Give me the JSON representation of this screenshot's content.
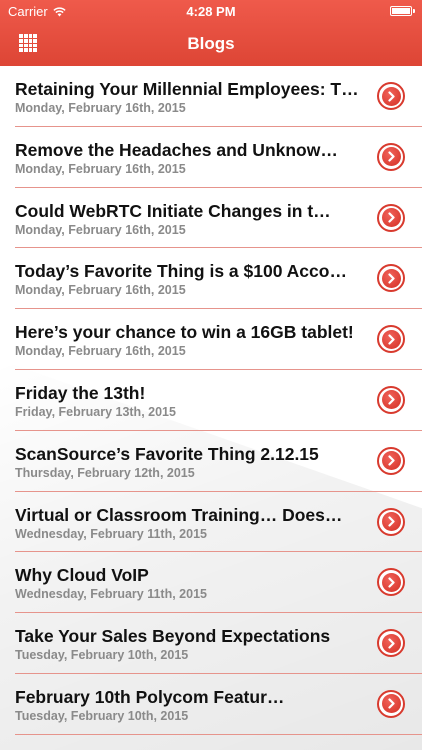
{
  "status_bar": {
    "carrier": "Carrier",
    "time": "4:28 PM",
    "battery_level": 1.0
  },
  "nav": {
    "title": "Blogs",
    "menu_icon": "grid-icon"
  },
  "posts": [
    {
      "title": "Retaining Your Millennial Employees: T…",
      "date": "Monday, February 16th, 2015"
    },
    {
      "title": "Remove the Headaches and Unknow…",
      "date": "Monday, February 16th, 2015"
    },
    {
      "title": "Could WebRTC Initiate Changes in t…",
      "date": "Monday, February 16th, 2015"
    },
    {
      "title": "Today’s Favorite Thing is a $100 Acco…",
      "date": "Monday, February 16th, 2015"
    },
    {
      "title": "Here’s your chance to win a 16GB tablet!",
      "date": "Monday, February 16th, 2015"
    },
    {
      "title": "Friday the 13th!",
      "date": "Friday, February 13th, 2015"
    },
    {
      "title": "ScanSource’s Favorite Thing 2.12.15",
      "date": "Thursday, February 12th, 2015"
    },
    {
      "title": "Virtual or Classroom Training… Does…",
      "date": "Wednesday, February 11th, 2015"
    },
    {
      "title": "Why Cloud VoIP",
      "date": "Wednesday, February 11th, 2015"
    },
    {
      "title": "Take Your Sales Beyond Expectations",
      "date": "Tuesday, February 10th, 2015"
    },
    {
      "title": "February 10th Polycom Featur…",
      "date": "Tuesday, February 10th, 2015"
    }
  ],
  "colors": {
    "header": "#e44e3f",
    "accent": "#d83a2e",
    "separator": "#e6948c"
  }
}
